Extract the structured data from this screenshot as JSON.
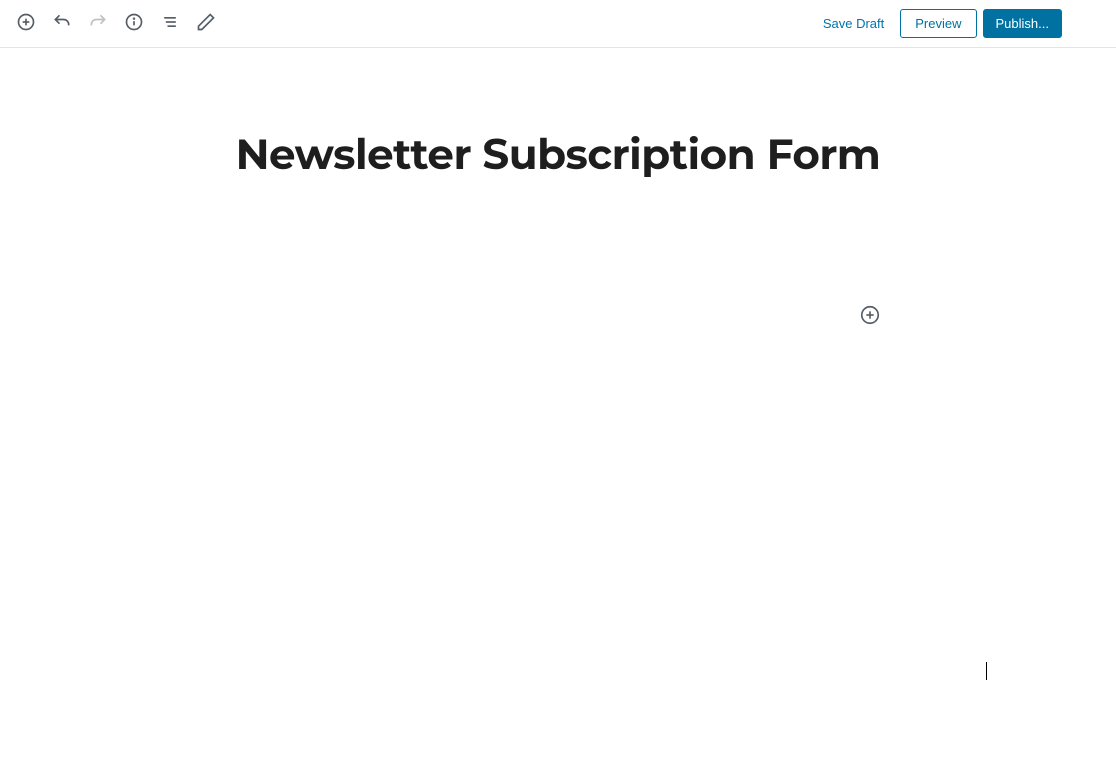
{
  "toolbar": {
    "save_draft_label": "Save Draft",
    "preview_label": "Preview",
    "publish_label": "Publish..."
  },
  "editor": {
    "title": "Newsletter Subscription Form"
  }
}
